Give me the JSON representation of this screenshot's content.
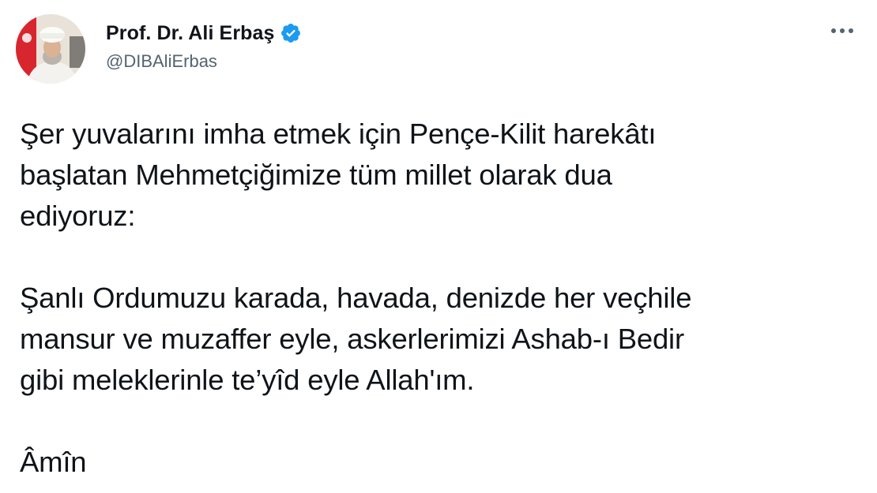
{
  "author": {
    "display_name": "Prof. Dr. Ali Erbaş",
    "handle": "@DIBAliErbas",
    "verified": true,
    "verified_color": "#1d9bf0"
  },
  "icons": {
    "verified": "verified-badge-icon",
    "more": "more-options-icon"
  },
  "tweet": {
    "paragraph1_lines": [
      "Şer yuvalarını imha etmek için Pençe-Kilit harekâtı",
      "başlatan Mehmetçiğimize tüm millet olarak dua",
      "ediyoruz:"
    ],
    "paragraph2_lines": [
      "Şanlı Ordumuzu karada, havada, denizde her veçhile",
      "mansur ve muzaffer eyle, askerlerimizi Ashab-ı Bedir",
      "gibi meleklerinle te’yîd eyle Allah'ım."
    ],
    "paragraph3_lines": [
      "Âmîn"
    ]
  }
}
